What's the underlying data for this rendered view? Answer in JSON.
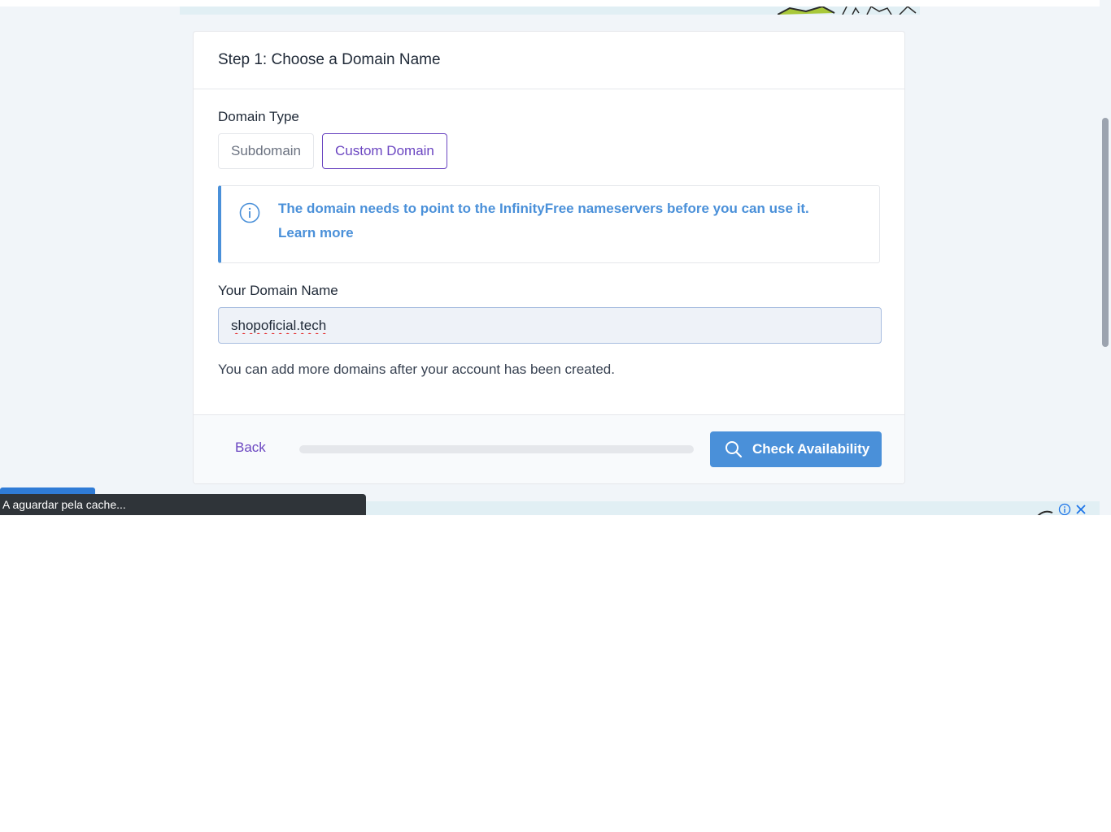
{
  "card": {
    "title": "Step 1: Choose a Domain Name"
  },
  "domain_type": {
    "label": "Domain Type",
    "options": [
      {
        "label": "Subdomain",
        "selected": false
      },
      {
        "label": "Custom Domain",
        "selected": true
      }
    ]
  },
  "alert": {
    "message": "The domain needs to point to the InfinityFree nameservers before you can use it.",
    "link": "Learn more",
    "icon": "info-circle-icon",
    "color": "#4a90d9"
  },
  "domain_name": {
    "label": "Your Domain Name",
    "value": "shopoficial.tech"
  },
  "help_text": "You can add more domains after your account has been created.",
  "footer": {
    "back_label": "Back",
    "progress": 0,
    "check_label": "Check Availability",
    "check_icon": "search-icon"
  },
  "status_bar": {
    "text": "A aguardar pela cache..."
  },
  "colors": {
    "accent": "#6b46c1",
    "primary": "#4a90d9",
    "background": "#f1f5f9"
  }
}
